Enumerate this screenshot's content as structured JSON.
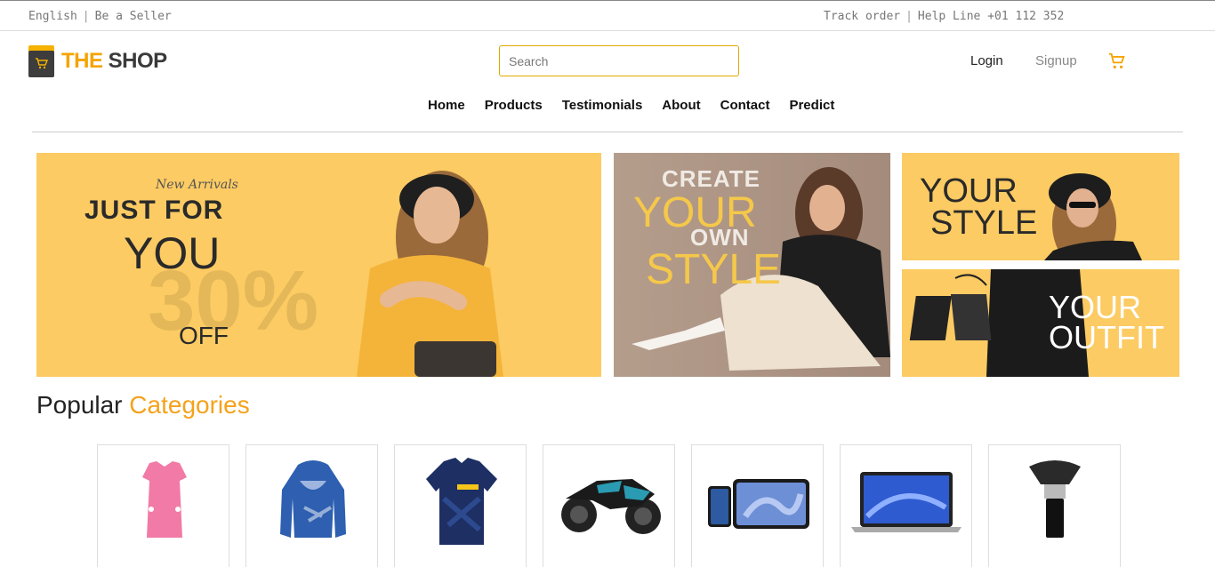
{
  "topbar": {
    "language": "English",
    "seller": "Be a Seller",
    "track": "Track order",
    "helpline": "Help Line +01 112 352"
  },
  "brand": {
    "the": "THE",
    "shop": "SHOP",
    "accent": "#f5a400"
  },
  "search": {
    "placeholder": "Search",
    "value": ""
  },
  "auth": {
    "login": "Login",
    "signup": "Signup"
  },
  "icons": {
    "cart": "cart-icon",
    "logo": "shopping-cart-icon"
  },
  "nav": [
    "Home",
    "Products",
    "Testimonials",
    "About",
    "Contact",
    "Predict"
  ],
  "banners": {
    "main": {
      "new": "New Arrivals",
      "just": "JUST FOR",
      "you": "YOU",
      "pct": "30%",
      "off": "OFF"
    },
    "create": {
      "create": "CREATE",
      "your": "YOUR",
      "own": "OWN",
      "style": "STYLE"
    },
    "style": {
      "l1": "YOUR",
      "l2": "STYLE"
    },
    "outfit": {
      "l1": "YOUR",
      "l2": "OUTFIT"
    }
  },
  "categories": {
    "title_a": "Popular",
    "title_b": "Categories",
    "items": [
      "dress",
      "hoodie",
      "jersey",
      "motorbike",
      "tablet",
      "laptop",
      "makeup-brush"
    ]
  }
}
